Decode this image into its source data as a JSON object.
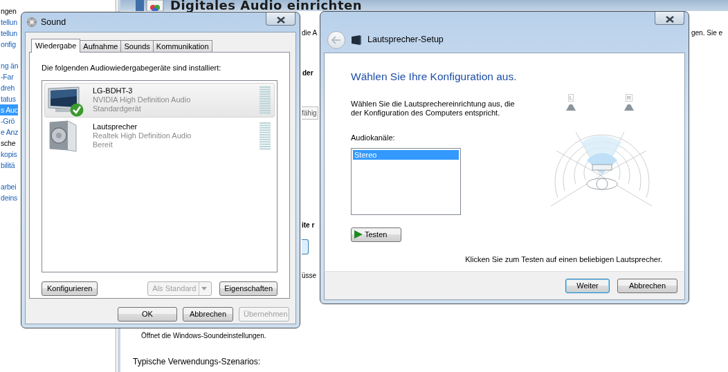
{
  "sidebar": {
    "items": [
      {
        "text": "ngen",
        "kind": "plain",
        "selected": false
      },
      {
        "text": "tellun",
        "kind": "link",
        "selected": false
      },
      {
        "text": "tellun",
        "kind": "link",
        "selected": false
      },
      {
        "text": "onfig",
        "kind": "link",
        "selected": false
      },
      {
        "text": "ng än",
        "kind": "link",
        "selected": false
      },
      {
        "text": "-Far",
        "kind": "link",
        "selected": false
      },
      {
        "text": "dreh",
        "kind": "link",
        "selected": false
      },
      {
        "text": "tatus",
        "kind": "link",
        "selected": false
      },
      {
        "text": "s Auc",
        "kind": "link",
        "selected": true
      },
      {
        "text": "-Grö",
        "kind": "link",
        "selected": false
      },
      {
        "text": "e Anz",
        "kind": "link",
        "selected": false
      },
      {
        "text": "sche",
        "kind": "plain",
        "selected": false
      },
      {
        "text": "kopis",
        "kind": "link",
        "selected": false
      },
      {
        "text": "bilitä",
        "kind": "link",
        "selected": false
      },
      {
        "text": "arbei",
        "kind": "link",
        "selected": false
      },
      {
        "text": "deins",
        "kind": "link",
        "selected": false
      }
    ]
  },
  "help_window": {
    "title": "Digitales Audio einrichten",
    "intro_left": "die A",
    "intro_right": "gen. Sie e",
    "heading_1": "der",
    "field_text": "fähig",
    "heading_2": "ite r",
    "text_fragment": "üsse",
    "description": "Öffnet die Windows-Soundeinstellungen.",
    "subheading": "Typische Verwendungs-Szenarios:"
  },
  "sound_dialog": {
    "title": "Sound",
    "tabs": [
      {
        "label": "Wiedergabe",
        "selected": true
      },
      {
        "label": "Aufnahme",
        "selected": false
      },
      {
        "label": "Sounds",
        "selected": false
      },
      {
        "label": "Kommunikation",
        "selected": false
      }
    ],
    "instruction": "Die folgenden Audiowiedergabegeräte sind installiert:",
    "devices": [
      {
        "kind": "monitor",
        "name": "LG-BDHT-3",
        "driver": "NVIDIA High Definition Audio",
        "status": "Standardgerät",
        "default": true,
        "selected": true
      },
      {
        "kind": "speaker",
        "name": "Lautsprecher",
        "driver": "Realtek High Definition Audio",
        "status": "Bereit",
        "default": false,
        "selected": false
      }
    ],
    "device_buttons": [
      {
        "label": "Konfigurieren",
        "disabled": false,
        "dropdown": false
      },
      {
        "label": "Als Standard",
        "disabled": true,
        "dropdown": true
      },
      {
        "label": "Eigenschaften",
        "disabled": false,
        "dropdown": false
      }
    ],
    "buttons": [
      {
        "label": "OK",
        "disabled": false
      },
      {
        "label": "Abbrechen",
        "disabled": false
      },
      {
        "label": "Übernehmen",
        "disabled": true
      }
    ]
  },
  "speaker_setup": {
    "title": "Lautsprecher-Setup",
    "heading": "Wählen Sie Ihre Konfiguration aus.",
    "description": "Wählen Sie die Lautsprechereinrichtung aus, die der Konfiguration des Computers entspricht.",
    "channels_label": "Audiokanäle:",
    "channels": [
      {
        "label": "Stereo",
        "selected": true
      }
    ],
    "test_button": "Testen",
    "speakers": [
      {
        "label": "L"
      },
      {
        "label": "R"
      }
    ],
    "hint": "Klicken Sie zum Testen auf einen beliebigen Lautsprecher.",
    "buttons": [
      {
        "label": "Weiter",
        "default": true
      },
      {
        "label": "Abbrechen",
        "default": false
      }
    ]
  }
}
